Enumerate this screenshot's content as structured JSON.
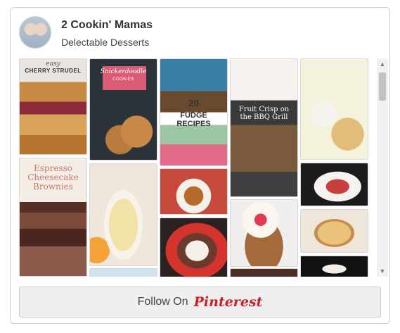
{
  "profile": {
    "name": "2 Cookin' Mamas",
    "board": "Delectable Desserts"
  },
  "pins": {
    "cherry_strudel": {
      "text_top": "easy",
      "text_main": "CHERRY STRUDEL"
    },
    "snickerdoodle": {
      "text_main": "Snickerdoodle",
      "text_sub": "COOKIES"
    },
    "fudge": {
      "text_num": "20",
      "text_main": "FUDGE RECIPES"
    },
    "fruit_crisp": {
      "text_main": "Fruit Crisp on the BBQ Grill"
    },
    "espresso": {
      "text_main": "Espresso Cheesecake Brownies"
    }
  },
  "follow_button": {
    "label": "Follow On",
    "brand": "Pinterest"
  }
}
